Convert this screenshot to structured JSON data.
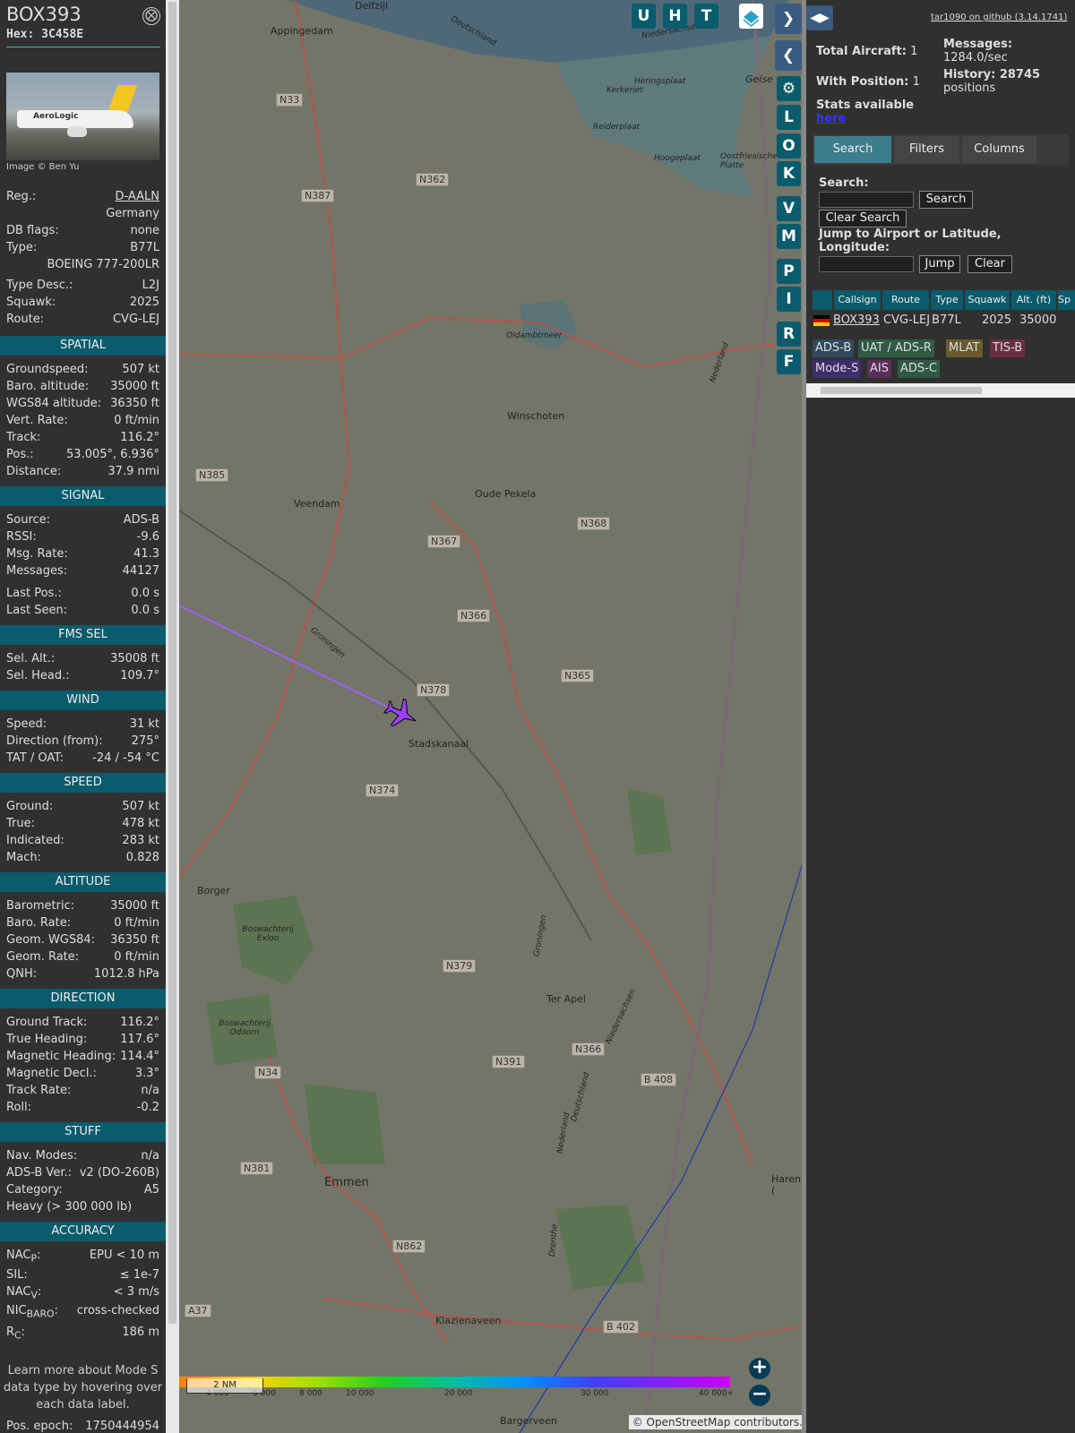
{
  "sidebar": {
    "ident": "BOX393",
    "hex": "Hex: 3C458E",
    "close_label": "⨂",
    "photo_logo": "AeroLogic",
    "photo_credit": "Image © Ben Yu",
    "reg_label": "Reg.:",
    "reg_value": "D-AALN",
    "country": "Germany",
    "dbflags_label": "DB flags:",
    "dbflags_value": "none",
    "type_label": "Type:",
    "type_value": "B77L",
    "type_full": "BOEING 777-200LR",
    "typedesc_label": "Type Desc.:",
    "typedesc_value": "L2J",
    "squawk_label": "Squawk:",
    "squawk_value": "2025",
    "route_label": "Route:",
    "route_value": "CVG-LEJ",
    "spatial": {
      "title": "SPATIAL",
      "gs_l": "Groundspeed:",
      "gs_v": "507 kt",
      "baro_l": "Baro. altitude:",
      "baro_v": "35000 ft",
      "wgs_l": "WGS84 altitude:",
      "wgs_v": "36350 ft",
      "vr_l": "Vert. Rate:",
      "vr_v": "0 ft/min",
      "track_l": "Track:",
      "track_v": "116.2°",
      "pos_l": "Pos.:",
      "pos_v": "53.005°, 6.936°",
      "dist_l": "Distance:",
      "dist_v": "37.9 nmi"
    },
    "signal": {
      "title": "SIGNAL",
      "src_l": "Source:",
      "src_v": "ADS-B",
      "rssi_l": "RSSI:",
      "rssi_v": "-9.6",
      "rate_l": "Msg. Rate:",
      "rate_v": "41.3",
      "msgs_l": "Messages:",
      "msgs_v": "44127",
      "lpos_l": "Last Pos.:",
      "lpos_v": "0.0 s",
      "lseen_l": "Last Seen:",
      "lseen_v": "0.0 s"
    },
    "fms": {
      "title": "FMS SEL",
      "alt_l": "Sel. Alt.:",
      "alt_v": "35008 ft",
      "head_l": "Sel. Head.:",
      "head_v": "109.7°"
    },
    "wind": {
      "title": "WIND",
      "spd_l": "Speed:",
      "spd_v": "31 kt",
      "dir_l": "Direction (from):",
      "dir_v": "275°",
      "tat_l": "TAT / OAT:",
      "tat_v": "-24 / -54 °C"
    },
    "speed": {
      "title": "SPEED",
      "gnd_l": "Ground:",
      "gnd_v": "507 kt",
      "true_l": "True:",
      "true_v": "478 kt",
      "ind_l": "Indicated:",
      "ind_v": "283 kt",
      "mach_l": "Mach:",
      "mach_v": "0.828"
    },
    "altitude": {
      "title": "ALTITUDE",
      "baro_l": "Barometric:",
      "baro_v": "35000 ft",
      "brate_l": "Baro. Rate:",
      "brate_v": "0 ft/min",
      "geom_l": "Geom. WGS84:",
      "geom_v": "36350 ft",
      "grate_l": "Geom. Rate:",
      "grate_v": "0 ft/min",
      "qnh_l": "QNH:",
      "qnh_v": "1012.8 hPa"
    },
    "direction": {
      "title": "DIRECTION",
      "gt_l": "Ground Track:",
      "gt_v": "116.2°",
      "th_l": "True Heading:",
      "th_v": "117.6°",
      "mh_l": "Magnetic Heading:",
      "mh_v": "114.4°",
      "md_l": "Magnetic Decl.:",
      "md_v": "3.3°",
      "tr_l": "Track Rate:",
      "tr_v": "n/a",
      "roll_l": "Roll:",
      "roll_v": "-0.2"
    },
    "stuff": {
      "title": "STUFF",
      "nav_l": "Nav. Modes:",
      "nav_v": "n/a",
      "ver_l": "ADS-B Ver.:",
      "ver_v": "v2 (DO-260B)",
      "cat_l": "Category:",
      "cat_v": "A5",
      "heavy": "Heavy (> 300 000 lb)"
    },
    "accuracy": {
      "title": "ACCURACY",
      "nacp_l": "NAC",
      "nacp_sub": "P",
      "nacp_v": "EPU < 10 m",
      "sil_l": "SIL:",
      "sil_v": "≤ 1e-7",
      "nacv_l": "NAC",
      "nacv_sub": "V",
      "nacv_v": "< 3 m/s",
      "nic_l": "NIC",
      "nic_sub": "BARO",
      "nic_v": "cross-checked",
      "rc_l": "R",
      "rc_sub": "C",
      "rc_v": "186 m"
    },
    "note": "Learn more about Mode S data type by hovering over each data label.",
    "epoch_l": "Pos. epoch:",
    "epoch_v": "1750444954"
  },
  "map": {
    "buttons": {
      "u": "U",
      "h": "H",
      "t": "T",
      "l": "L",
      "o": "O",
      "k": "K",
      "v": "V",
      "m": "M",
      "p": "P",
      "i": "I",
      "r": "R",
      "f": "F"
    },
    "places": [
      "Delfzijl",
      "Appingedam",
      "Winschoten",
      "Veendam",
      "Oude Pekela",
      "Stadskanaal",
      "Borger",
      "Ter Apel",
      "Emmen",
      "Klazienaveen",
      "Haren (",
      "Bargerveen",
      "Kerkeriet",
      "Reiderplaat",
      "Hoogeplaat",
      "Oldambtmeer",
      "Heringsplaat",
      "Boswachterij Exloo",
      "Boswachterij Odoorn",
      "Geise",
      "Oostfriesische Platte",
      "Groningen",
      "Nederland",
      "Niedersachsen",
      "Deutschland",
      "Drenthe",
      "Groningen",
      "Nederland",
      "Deutschland",
      "Niedersachsen"
    ],
    "roads": [
      "N33",
      "N387",
      "N362",
      "N385",
      "N367",
      "N368",
      "N366",
      "N378",
      "N365",
      "N374",
      "N379",
      "N391",
      "N366",
      "B 408",
      "N34",
      "N381",
      "N862",
      "A37",
      "B 402"
    ],
    "altitude_scale": [
      "4 000",
      "6 000",
      "8 000",
      "10 000",
      "20 000",
      "30 000",
      "40 000+"
    ],
    "scale_bar": "2 NM",
    "attribution_prefix": "© ",
    "attribution_link": "OpenStreetMap",
    "attribution_suffix": " contributors.",
    "zoom_in": "+",
    "zoom_out": "−"
  },
  "right": {
    "github": "tar1090 on github (3.14.1741)",
    "total_label": "Total Aircraft:",
    "total_value": "1",
    "withpos_label": "With Position:",
    "withpos_value": "1",
    "messages_label": "Messages:",
    "messages_value": "1284.0/sec",
    "history_label": "History: 28745",
    "history_value": "positions",
    "stats_text": "Stats available",
    "stats_link": "here",
    "tabs": [
      "Search",
      "Filters",
      "Columns"
    ],
    "search_label": "Search:",
    "search_button": "Search",
    "clear_search_button": "Clear Search",
    "jump_label": "Jump to Airport or Latitude, Longitude:",
    "jump_button": "Jump",
    "clear_button": "Clear",
    "table": {
      "headers": [
        "Callsign",
        "Route",
        "Type",
        "Squawk",
        "Alt. (ft)",
        "Sp"
      ],
      "row": [
        "BOX393",
        "CVG-LEJ",
        "B77L",
        "2025",
        "35000"
      ]
    },
    "badges": [
      "ADS-B",
      "UAT / ADS-R",
      "MLAT",
      "TIS-B",
      "Mode-S",
      "AIS",
      "ADS-C"
    ]
  }
}
